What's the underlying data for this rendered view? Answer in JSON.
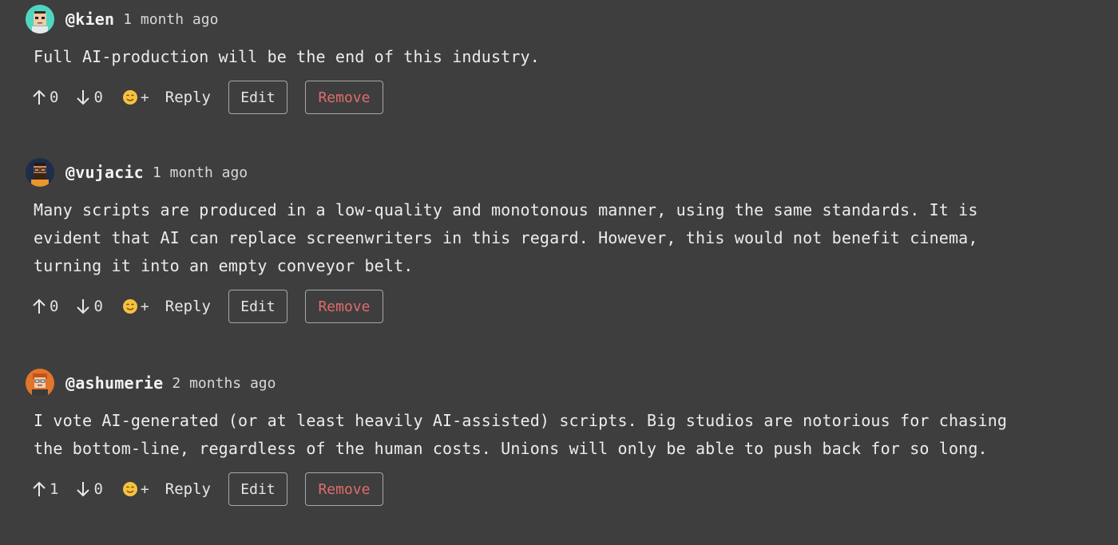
{
  "icons": {
    "upvote": "arrow-up-icon",
    "downvote": "arrow-down-icon",
    "reaction": "smiley-add-icon"
  },
  "colors": {
    "background": "#3e3e3e",
    "remove": "#e06b6b",
    "avatar_kien": "#4fd6c2",
    "avatar_vujacic": "#1e2d4a",
    "avatar_ashumerie": "#e0752b"
  },
  "comments": [
    {
      "username": "@kien",
      "timestamp": "1 month ago",
      "body": "Full AI-production will be the end of this industry.",
      "upvotes": "0",
      "downvotes": "0",
      "reaction_plus": "+",
      "reply_label": "Reply",
      "edit_label": "Edit",
      "remove_label": "Remove"
    },
    {
      "username": "@vujacic",
      "timestamp": "1 month ago",
      "body": "Many scripts are produced in a low-quality and monotonous manner, using the same standards. It is\nevident that AI can replace screenwriters in this regard. However, this would not benefit cinema,\nturning it into an empty conveyor belt.",
      "upvotes": "0",
      "downvotes": "0",
      "reaction_plus": "+",
      "reply_label": "Reply",
      "edit_label": "Edit",
      "remove_label": "Remove"
    },
    {
      "username": "@ashumerie",
      "timestamp": "2 months ago",
      "body": "I vote AI-generated (or at least heavily AI-assisted) scripts. Big studios are notorious for chasing\nthe bottom-line, regardless of the human costs. Unions will only be able to push back for so long.",
      "upvotes": "1",
      "downvotes": "0",
      "reaction_plus": "+",
      "reply_label": "Reply",
      "edit_label": "Edit",
      "remove_label": "Remove"
    }
  ]
}
